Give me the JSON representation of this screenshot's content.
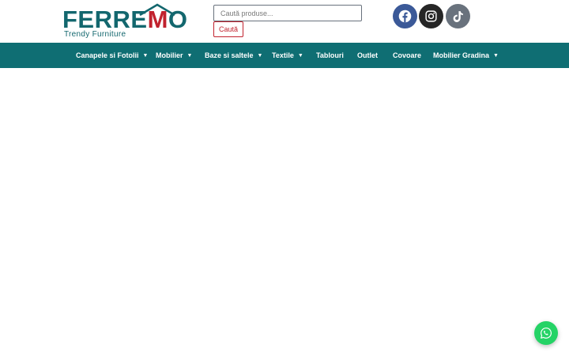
{
  "header": {
    "logo": {
      "brand": "FERREMO",
      "tagline": "Trendy Furniture"
    },
    "search": {
      "placeholder": "Caută produse...",
      "button_label": "Caută"
    },
    "social": [
      {
        "name": "facebook",
        "icon": "facebook-icon",
        "color": "#3b5998"
      },
      {
        "name": "instagram",
        "icon": "instagram-icon",
        "color": "#262626"
      },
      {
        "name": "tiktok",
        "icon": "tiktok-icon",
        "color": "#69727d"
      }
    ]
  },
  "nav": {
    "color": "#0f6e73",
    "items": [
      {
        "label": "Canapele si Fotolii",
        "has_dropdown": true
      },
      {
        "label": "Mobilier",
        "has_dropdown": true
      },
      {
        "label": "Baze si saltele",
        "has_dropdown": true
      },
      {
        "label": "Textile",
        "has_dropdown": true
      },
      {
        "label": "Tablouri",
        "has_dropdown": false
      },
      {
        "label": "Outlet",
        "has_dropdown": false
      },
      {
        "label": "Covoare",
        "has_dropdown": false
      },
      {
        "label": "Mobilier Gradina",
        "has_dropdown": true
      }
    ]
  },
  "chat_widget": {
    "icon": "whatsapp-icon",
    "color": "#25d366"
  }
}
